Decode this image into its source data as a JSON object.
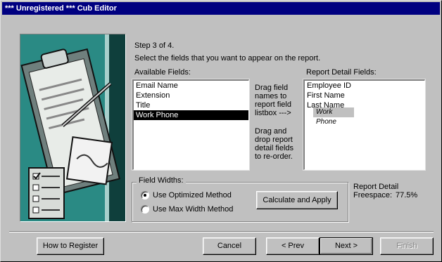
{
  "window": {
    "title": "*** Unregistered *** Cub Editor"
  },
  "wizard": {
    "step": "Step 3 of 4.",
    "instruction": "Select the fields that you want to appear on the report."
  },
  "available": {
    "label": "Available Fields:",
    "items": [
      "Email Name",
      "Extension",
      "Title",
      "Work Phone"
    ],
    "selected_index": 3
  },
  "report": {
    "label": "Report Detail Fields:",
    "items": [
      "Employee ID",
      "First Name",
      "Last Name"
    ],
    "drag_ghost": "Work Phone"
  },
  "help": {
    "drag_to": [
      "Drag field",
      "names to",
      "report field",
      "listbox --->"
    ],
    "reorder": [
      "Drag and",
      "drop report",
      "detail fields",
      "to re-order."
    ]
  },
  "field_widths": {
    "title": "Field Widths:",
    "optimized": "Use Optimized Method",
    "maxwidth": "Use Max Width Method",
    "selected": "optimized",
    "calc_button": "Calculate and Apply"
  },
  "freespace": {
    "line1": "Report Detail",
    "line2_label": "Freespace:",
    "value": "77.5%"
  },
  "buttons": {
    "register": "How to Register",
    "cancel": "Cancel",
    "prev": "< Prev",
    "next": "Next >",
    "finish": "Finish"
  },
  "colors": {
    "titlebar": "#000080",
    "face": "#c0c0c0"
  },
  "art": {
    "icon": "clipboard-checklist-illustration"
  }
}
